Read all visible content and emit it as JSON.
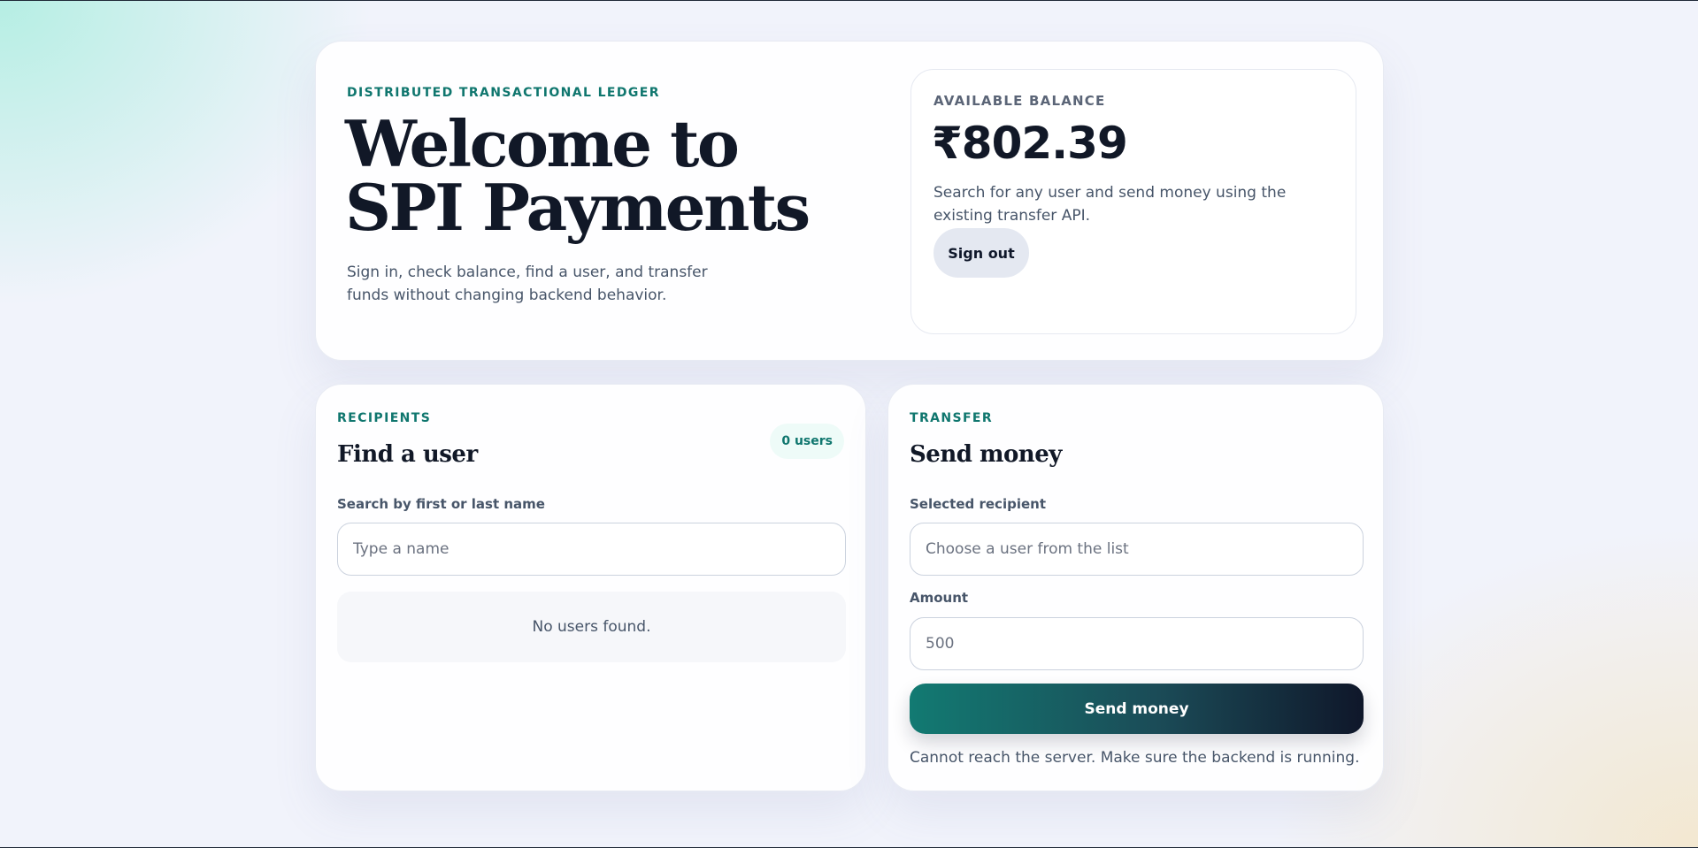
{
  "hero": {
    "eyebrow": "DISTRIBUTED TRANSACTIONAL LEDGER",
    "title_line1": "Welcome to",
    "title_line2": "SPI Payments",
    "subtitle": "Sign in, check balance, find a user, and transfer funds without changing backend behavior."
  },
  "balance": {
    "label": "AVAILABLE BALANCE",
    "amount": "₹802.39",
    "description": "Search for any user and send money using the existing transfer API.",
    "signout_label": "Sign out"
  },
  "recipients": {
    "eyebrow": "RECIPIENTS",
    "title": "Find a user",
    "count_badge": "0 users",
    "search_label": "Search by first or last name",
    "search_placeholder": "Type a name",
    "empty_message": "No users found."
  },
  "transfer": {
    "eyebrow": "TRANSFER",
    "title": "Send money",
    "recipient_label": "Selected recipient",
    "recipient_placeholder": "Choose a user from the list",
    "amount_label": "Amount",
    "amount_placeholder": "500",
    "send_label": "Send money",
    "status_message": "Cannot reach the server. Make sure the backend is running."
  },
  "colors": {
    "accent": "#0f766e",
    "text_dark": "#111827",
    "muted": "#475569"
  }
}
